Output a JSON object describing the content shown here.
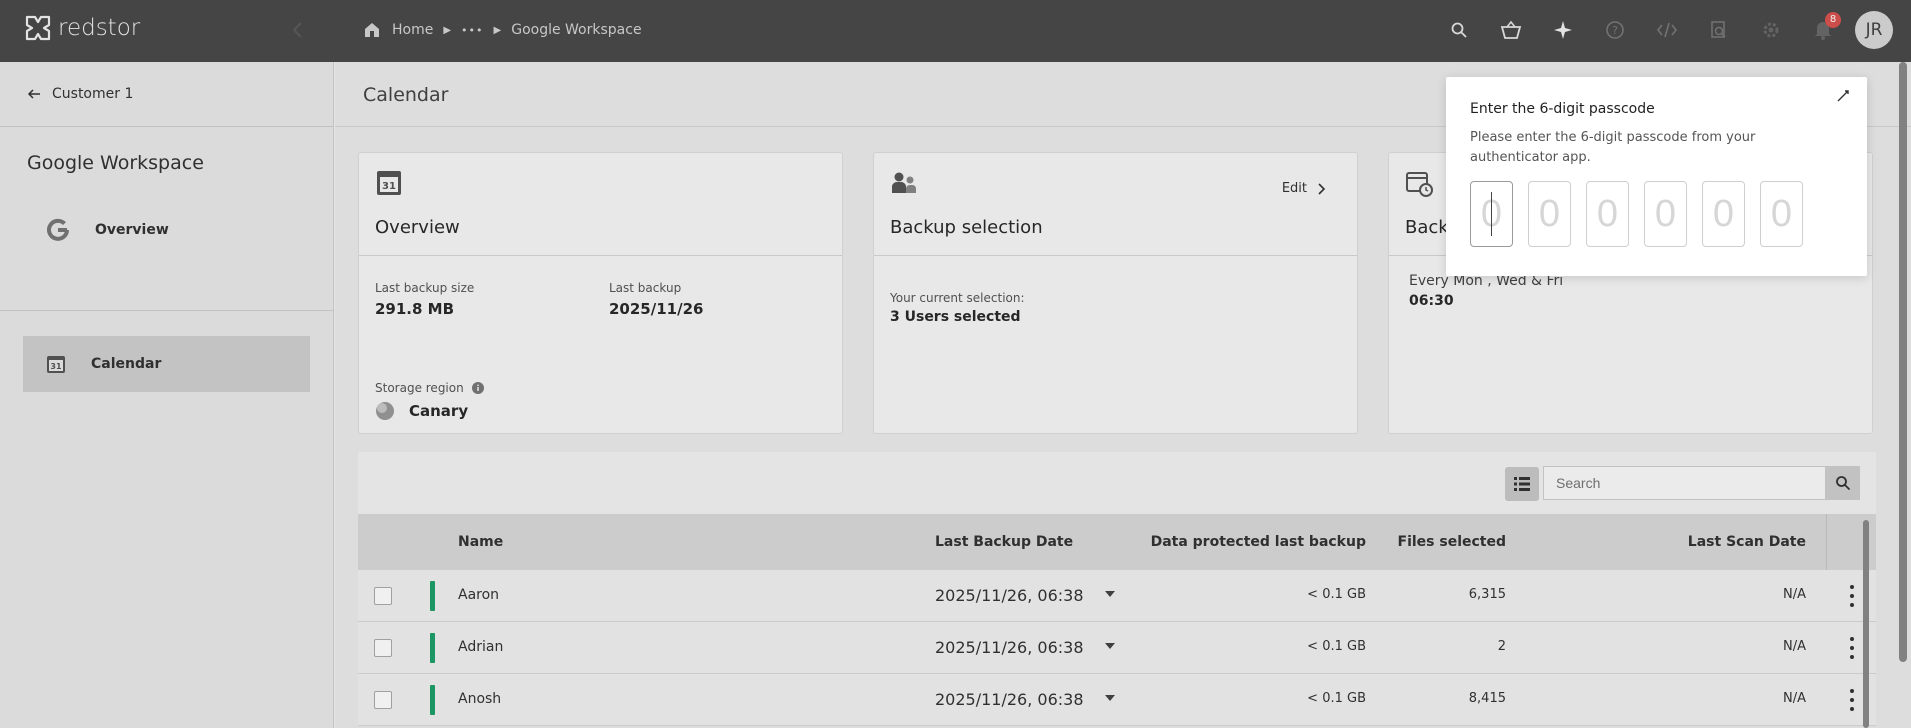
{
  "app": {
    "name": "redstor"
  },
  "header": {
    "breadcrumbs": [
      "Home",
      "•••",
      "Google Workspace"
    ],
    "notifications_count": "8",
    "user_initials": "JR",
    "icons": [
      "search-icon",
      "basket-icon",
      "sparkle-icon",
      "help-icon",
      "code-icon",
      "search-document-icon",
      "gear-icon",
      "bell-icon"
    ]
  },
  "sidebar": {
    "back_label": "Customer 1",
    "title": "Google Workspace",
    "items": [
      {
        "label": "Overview",
        "icon": "google-icon",
        "active": false
      },
      {
        "label": "Calendar",
        "icon": "calendar-icon",
        "active": true
      }
    ]
  },
  "main": {
    "page_title": "Calendar",
    "overview_card": {
      "title": "Overview",
      "last_backup_size_label": "Last backup size",
      "last_backup_size": "291.8 MB",
      "last_backup_label": "Last backup",
      "last_backup": "2025/11/26",
      "storage_region_label": "Storage region",
      "storage_region": "Canary"
    },
    "selection_card": {
      "title": "Backup selection",
      "edit_label": "Edit",
      "current_label": "Your current selection:",
      "current_value": "3 Users selected"
    },
    "schedule_card": {
      "title": "Back",
      "schedule_days": "Every Mon , Wed & Fri",
      "schedule_time": "06:30"
    },
    "search": {
      "placeholder": "Search"
    },
    "table": {
      "columns": {
        "name": "Name",
        "last_backup_date": "Last Backup Date",
        "data_protected": "Data protected last backup",
        "files_selected": "Files selected",
        "last_scan_date": "Last Scan Date"
      },
      "rows": [
        {
          "name": "Aaron",
          "last_backup": "2025/11/26, 06:38",
          "data": "< 0.1 GB",
          "files": "6,315",
          "scan": "N/A"
        },
        {
          "name": "Adrian",
          "last_backup": "2025/11/26, 06:38",
          "data": "< 0.1 GB",
          "files": "2",
          "scan": "N/A"
        },
        {
          "name": "Anosh",
          "last_backup": "2025/11/26, 06:38",
          "data": "< 0.1 GB",
          "files": "8,415",
          "scan": "N/A"
        }
      ]
    }
  },
  "modal": {
    "title": "Enter the 6-digit passcode",
    "description": "Please enter the 6-digit passcode from your authenticator app.",
    "digit_placeholders": [
      "0",
      "0",
      "0",
      "0",
      "0",
      "0"
    ]
  },
  "colors": {
    "topbar": "#4a4a4a",
    "status_ok": "#1ea06a",
    "badge": "#d9534f"
  }
}
